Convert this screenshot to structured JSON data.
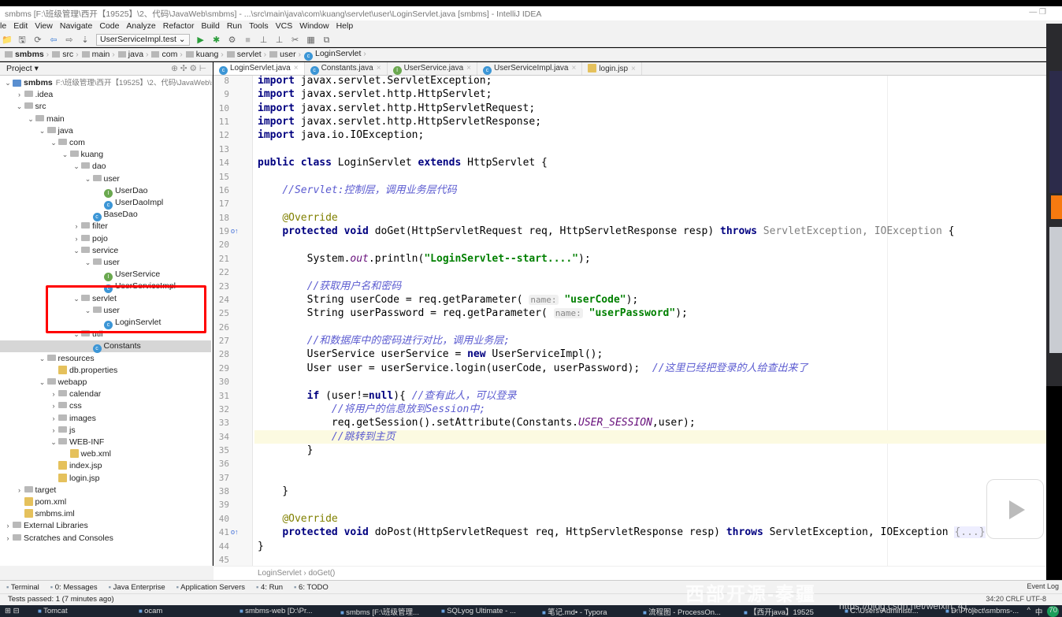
{
  "window": {
    "title": "smbms [F:\\班级管理\\西开【19525】\\2、代码\\JavaWeb\\smbms] - ...\\src\\main\\java\\com\\kuang\\servlet\\user\\LoginServlet.java [smbms] - IntelliJ IDEA",
    "controls": "—  ❐"
  },
  "menu": [
    "le",
    "Edit",
    "View",
    "Navigate",
    "Code",
    "Analyze",
    "Refactor",
    "Build",
    "Run",
    "Tools",
    "VCS",
    "Window",
    "Help"
  ],
  "toolbar": {
    "run_config": "UserServiceImpl.test ⌄"
  },
  "breadcrumb": [
    "smbms",
    "src",
    "main",
    "java",
    "com",
    "kuang",
    "servlet",
    "user",
    "LoginServlet"
  ],
  "project": {
    "header": "Project ▾",
    "tree": [
      {
        "l": 0,
        "a": "open",
        "ic": "mod",
        "t": "smbms",
        "extra": "F:\\班级管理\\西开【19525】\\2、代码\\JavaWeb\\sm"
      },
      {
        "l": 1,
        "a": "closed",
        "ic": "folder",
        "t": ".idea"
      },
      {
        "l": 1,
        "a": "open",
        "ic": "folder",
        "t": "src"
      },
      {
        "l": 2,
        "a": "open",
        "ic": "folder",
        "t": "main"
      },
      {
        "l": 3,
        "a": "open",
        "ic": "folder",
        "t": "java"
      },
      {
        "l": 4,
        "a": "open",
        "ic": "folder",
        "t": "com"
      },
      {
        "l": 5,
        "a": "open",
        "ic": "folder",
        "t": "kuang"
      },
      {
        "l": 6,
        "a": "open",
        "ic": "folder",
        "t": "dao"
      },
      {
        "l": 7,
        "a": "open",
        "ic": "folder",
        "t": "user"
      },
      {
        "l": 8,
        "a": "",
        "ic": "i",
        "t": "UserDao"
      },
      {
        "l": 8,
        "a": "",
        "ic": "c",
        "t": "UserDaoImpl"
      },
      {
        "l": 7,
        "a": "",
        "ic": "c",
        "t": "BaseDao"
      },
      {
        "l": 6,
        "a": "closed",
        "ic": "folder",
        "t": "filter"
      },
      {
        "l": 6,
        "a": "closed",
        "ic": "folder",
        "t": "pojo"
      },
      {
        "l": 6,
        "a": "open",
        "ic": "folder",
        "t": "service"
      },
      {
        "l": 7,
        "a": "open",
        "ic": "folder",
        "t": "user"
      },
      {
        "l": 8,
        "a": "",
        "ic": "i",
        "t": "UserService"
      },
      {
        "l": 8,
        "a": "",
        "ic": "c",
        "t": "UserServiceImpl"
      },
      {
        "l": 6,
        "a": "open",
        "ic": "folder",
        "t": "servlet"
      },
      {
        "l": 7,
        "a": "open",
        "ic": "folder",
        "t": "user"
      },
      {
        "l": 8,
        "a": "",
        "ic": "c",
        "t": "LoginServlet"
      },
      {
        "l": 6,
        "a": "open",
        "ic": "folder",
        "t": "util"
      },
      {
        "l": 7,
        "a": "",
        "ic": "c",
        "t": "Constants",
        "sel": true
      },
      {
        "l": 3,
        "a": "open",
        "ic": "folder",
        "t": "resources"
      },
      {
        "l": 4,
        "a": "",
        "ic": "file",
        "t": "db.properties"
      },
      {
        "l": 3,
        "a": "open",
        "ic": "folder",
        "t": "webapp"
      },
      {
        "l": 4,
        "a": "closed",
        "ic": "folder",
        "t": "calendar"
      },
      {
        "l": 4,
        "a": "closed",
        "ic": "folder",
        "t": "css"
      },
      {
        "l": 4,
        "a": "closed",
        "ic": "folder",
        "t": "images"
      },
      {
        "l": 4,
        "a": "closed",
        "ic": "folder",
        "t": "js"
      },
      {
        "l": 4,
        "a": "open",
        "ic": "folder",
        "t": "WEB-INF"
      },
      {
        "l": 5,
        "a": "",
        "ic": "file",
        "t": "web.xml"
      },
      {
        "l": 4,
        "a": "",
        "ic": "file",
        "t": "index.jsp"
      },
      {
        "l": 4,
        "a": "",
        "ic": "file",
        "t": "login.jsp"
      },
      {
        "l": 1,
        "a": "closed",
        "ic": "folder",
        "t": "target"
      },
      {
        "l": 1,
        "a": "",
        "ic": "file",
        "t": "pom.xml"
      },
      {
        "l": 1,
        "a": "",
        "ic": "file",
        "t": "smbms.iml"
      },
      {
        "l": 0,
        "a": "closed",
        "ic": "folder",
        "t": "External Libraries"
      },
      {
        "l": 0,
        "a": "closed",
        "ic": "folder",
        "t": "Scratches and Consoles"
      }
    ]
  },
  "tabs": [
    {
      "label": "LoginServlet.java",
      "icon": "c",
      "active": true
    },
    {
      "label": "Constants.java",
      "icon": "c"
    },
    {
      "label": "UserService.java",
      "icon": "i"
    },
    {
      "label": "UserServiceImpl.java",
      "icon": "c"
    },
    {
      "label": "login.jsp",
      "icon": "file"
    }
  ],
  "editor": {
    "current_line": "34",
    "lines": [
      {
        "n": "8",
        "t": [
          [
            "kw",
            "import"
          ],
          [
            "",
            " javax.servlet.ServletException;"
          ]
        ]
      },
      {
        "n": "9",
        "t": [
          [
            "kw",
            "import"
          ],
          [
            "",
            " javax.servlet.http.HttpServlet;"
          ]
        ]
      },
      {
        "n": "10",
        "t": [
          [
            "kw",
            "import"
          ],
          [
            "",
            " javax.servlet.http.HttpServletRequest;"
          ]
        ]
      },
      {
        "n": "11",
        "t": [
          [
            "kw",
            "import"
          ],
          [
            "",
            " javax.servlet.http.HttpServletResponse;"
          ]
        ]
      },
      {
        "n": "12",
        "t": [
          [
            "kw",
            "import"
          ],
          [
            "",
            " java.io.IOException;"
          ]
        ]
      },
      {
        "n": "13",
        "t": []
      },
      {
        "n": "14",
        "t": [
          [
            "kw",
            "public class"
          ],
          [
            "",
            " LoginServlet "
          ],
          [
            "kw",
            "extends"
          ],
          [
            "",
            " HttpServlet {"
          ]
        ]
      },
      {
        "n": "15",
        "t": []
      },
      {
        "n": "16",
        "t": [
          [
            "",
            "    "
          ],
          [
            "cm",
            "//Servlet:控制层，调用业务层代码"
          ]
        ]
      },
      {
        "n": "17",
        "t": []
      },
      {
        "n": "18",
        "t": [
          [
            "",
            "    "
          ],
          [
            "ann",
            "@Override"
          ]
        ]
      },
      {
        "n": "19",
        "mark": "o↑",
        "t": [
          [
            "",
            "    "
          ],
          [
            "kw",
            "protected void"
          ],
          [
            "",
            " doGet(HttpServletRequest req, HttpServletResponse resp) "
          ],
          [
            "kw",
            "throws"
          ],
          [
            "dim",
            " ServletException, IOException"
          ],
          [
            "",
            " {"
          ]
        ]
      },
      {
        "n": "20",
        "t": []
      },
      {
        "n": "21",
        "t": [
          [
            "",
            "        System."
          ],
          [
            "st",
            "out"
          ],
          [
            "",
            ".println("
          ],
          [
            "str",
            "\"LoginServlet--start....\""
          ],
          [
            "",
            ");"
          ]
        ]
      },
      {
        "n": "22",
        "t": []
      },
      {
        "n": "23",
        "t": [
          [
            "",
            "        "
          ],
          [
            "cm",
            "//获取用户名和密码"
          ]
        ]
      },
      {
        "n": "24",
        "t": [
          [
            "",
            "        String userCode = req.getParameter( "
          ],
          [
            "hint",
            "name:"
          ],
          [
            "str",
            " \"userCode\""
          ],
          [
            "",
            ");"
          ]
        ]
      },
      {
        "n": "25",
        "t": [
          [
            "",
            "        String userPassword = req.getParameter( "
          ],
          [
            "hint",
            "name:"
          ],
          [
            "str",
            " \"userPassword\""
          ],
          [
            "",
            ");"
          ]
        ]
      },
      {
        "n": "26",
        "t": []
      },
      {
        "n": "27",
        "t": [
          [
            "",
            "        "
          ],
          [
            "cm",
            "//和数据库中的密码进行对比，调用业务层;"
          ]
        ]
      },
      {
        "n": "28",
        "t": [
          [
            "",
            "        UserService userService = "
          ],
          [
            "kw",
            "new"
          ],
          [
            "",
            " UserServiceImpl();"
          ]
        ]
      },
      {
        "n": "29",
        "t": [
          [
            "",
            "        User user = userService.login(userCode, userPassword);  "
          ],
          [
            "cm",
            "//这里已经把登录的人给查出来了"
          ]
        ]
      },
      {
        "n": "30",
        "t": []
      },
      {
        "n": "31",
        "t": [
          [
            "",
            "        "
          ],
          [
            "kw",
            "if"
          ],
          [
            "",
            " (user!="
          ],
          [
            "kw",
            "null"
          ],
          [
            "",
            "){ "
          ],
          [
            "cm",
            "//查有此人，可以登录"
          ]
        ]
      },
      {
        "n": "32",
        "t": [
          [
            "",
            "            "
          ],
          [
            "cm",
            "//将用户的信息放到Session中;"
          ]
        ]
      },
      {
        "n": "33",
        "t": [
          [
            "",
            "            req.getSession().setAttribute(Constants."
          ],
          [
            "st",
            "USER_SESSION"
          ],
          [
            "",
            ",user);"
          ]
        ]
      },
      {
        "n": "34",
        "t": [
          [
            "",
            "            "
          ],
          [
            "cm",
            "//跳转到主页"
          ]
        ]
      },
      {
        "n": "35",
        "t": [
          [
            "",
            "        }"
          ]
        ]
      },
      {
        "n": "36",
        "t": []
      },
      {
        "n": "37",
        "t": []
      },
      {
        "n": "38",
        "t": [
          [
            "",
            "    }"
          ]
        ]
      },
      {
        "n": "39",
        "t": []
      },
      {
        "n": "40",
        "t": [
          [
            "",
            "    "
          ],
          [
            "ann",
            "@Override"
          ]
        ]
      },
      {
        "n": "41",
        "mark": "o↑",
        "t": [
          [
            "",
            "    "
          ],
          [
            "kw",
            "protected void"
          ],
          [
            "",
            " doPost(HttpServletRequest req, HttpServletResponse resp) "
          ],
          [
            "kw",
            "throws"
          ],
          [
            "",
            " ServletException, IOException "
          ],
          [
            "fld",
            "{...}"
          ]
        ]
      },
      {
        "n": "44",
        "t": [
          [
            "",
            "}"
          ]
        ]
      },
      {
        "n": "45",
        "t": []
      }
    ]
  },
  "editor_breadcrumb": [
    "LoginServlet",
    "doGet()"
  ],
  "tool_windows": [
    "Terminal",
    "0: Messages",
    "Java Enterprise",
    "Application Servers",
    "4: Run",
    "6: TODO"
  ],
  "event_log": "Event Log",
  "status": {
    "message": "Tests passed: 1 (7 minutes ago)",
    "position": "34:20",
    "line_sep": "CRLF",
    "encoding": "UTF-8"
  },
  "taskbar": [
    "Tomcat",
    "ocam",
    "smbms-web [D:\\Pr...",
    "smbms [F:\\班级管理...",
    "SQLyog Ultimate - ...",
    "笔记.md• - Typora",
    "流程图 - ProcessOn...",
    "【西开java】19525",
    "C:\\Users\\Administr...",
    "D:\\Project\\smbms-..."
  ],
  "tray": {
    "ime": "中",
    "badge": "70"
  },
  "watermark": {
    "text": "西部开源-秦疆",
    "url": "https://blog.csdn.net/weixin_41..."
  }
}
